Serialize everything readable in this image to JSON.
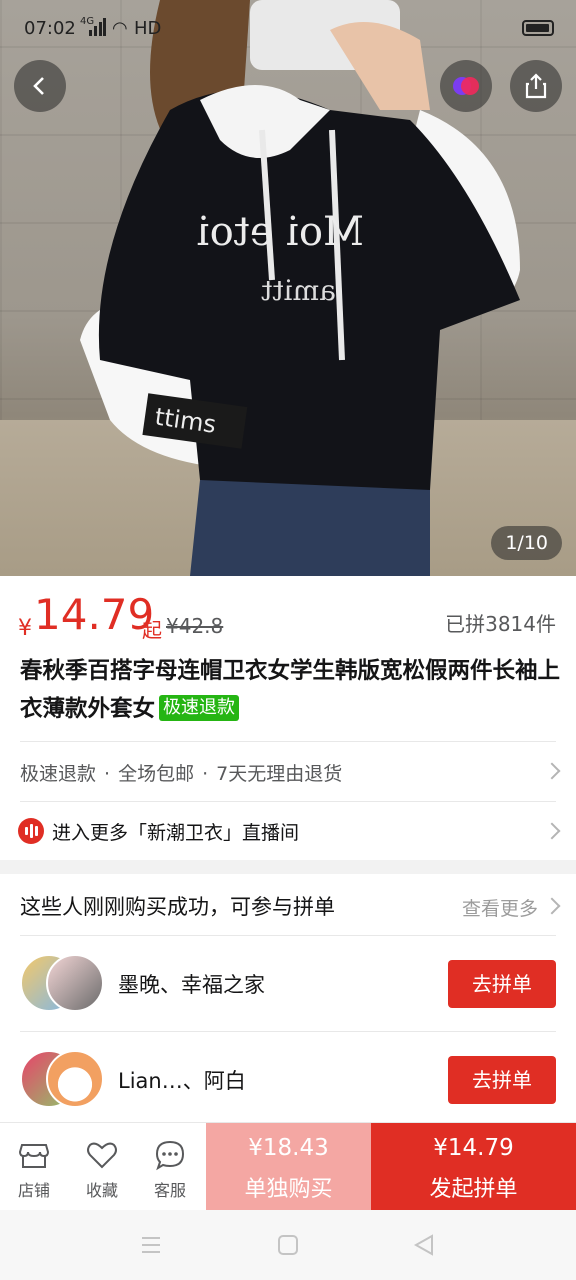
{
  "status_bar": {
    "time": "07:02",
    "network": "4G",
    "hd": "HD"
  },
  "gallery": {
    "counter": "1/10"
  },
  "price": {
    "currency": "¥",
    "amount": "14.79",
    "suffix": "起",
    "original": "¥42.8",
    "sold": "已拼3814件"
  },
  "product": {
    "title": "春秋季百搭字母连帽卫衣女学生韩版宽松假两件长袖上衣薄款外套女",
    "tag": "极速退款"
  },
  "services": {
    "items": [
      "极速退款",
      "全场包邮",
      "7天无理由退货"
    ],
    "separator": "·"
  },
  "live": {
    "text": "进入更多「新潮卫衣」直播间"
  },
  "group_section": {
    "title": "这些人刚刚购买成功，可参与拼单",
    "more": "查看更多",
    "rows": [
      {
        "names": "墨晚、幸福之家",
        "button": "去拼单"
      },
      {
        "names": "Lian…、阿白",
        "button": "去拼单"
      }
    ]
  },
  "bottom_bar": {
    "tools": [
      {
        "label": "店铺",
        "icon": "store-icon"
      },
      {
        "label": "收藏",
        "icon": "heart-icon"
      },
      {
        "label": "客服",
        "icon": "chat-icon"
      }
    ],
    "solo": {
      "price": "¥18.43",
      "label": "单独购买"
    },
    "group": {
      "price": "¥14.79",
      "label": "发起拼单"
    }
  },
  "colors": {
    "accent": "#e02e24",
    "tag_green": "#25b513",
    "solo_bg": "#f4a7a3"
  }
}
